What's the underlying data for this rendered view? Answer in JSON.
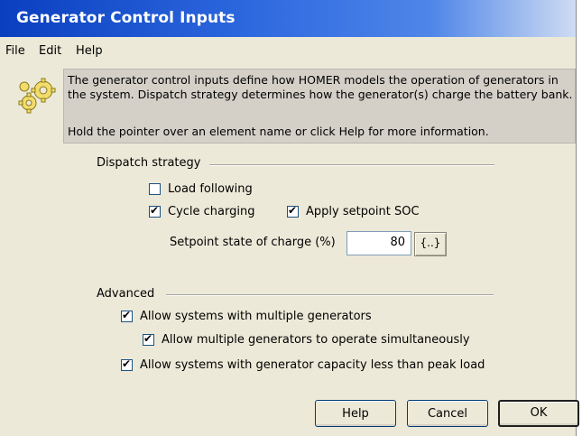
{
  "window": {
    "title": "Generator Control Inputs"
  },
  "menu": {
    "file": "File",
    "edit": "Edit",
    "help": "Help"
  },
  "info": {
    "icon": "gears-icon",
    "text1": "The generator control inputs define how HOMER models the operation of generators in the system. Dispatch strategy determines how the generator(s) charge the battery bank.",
    "text2": "Hold the pointer over an element name or click Help for more information."
  },
  "dispatch": {
    "label": "Dispatch strategy",
    "load_following": {
      "label": "Load following",
      "checked": false
    },
    "cycle_charging": {
      "label": "Cycle charging",
      "checked": true
    },
    "apply_setpoint": {
      "label": "Apply setpoint SOC",
      "checked": true
    },
    "setpoint_label": "Setpoint state of charge (%)",
    "setpoint_value": "80",
    "sensitivity_button": "{..}"
  },
  "advanced": {
    "label": "Advanced",
    "multiple_generators": {
      "label": "Allow systems with multiple generators",
      "checked": true
    },
    "simultaneous": {
      "label": "Allow multiple generators to operate simultaneously",
      "checked": true
    },
    "capacity_less": {
      "label": "Allow systems with generator capacity less than peak load",
      "checked": true
    }
  },
  "buttons": {
    "help": "Help",
    "cancel": "Cancel",
    "ok": "OK"
  },
  "check_glyph": "✔",
  "colors": {
    "title_bar": "#0a3fbf",
    "dialog_bg": "#ece9d8",
    "info_bg": "#d4d0c8"
  }
}
